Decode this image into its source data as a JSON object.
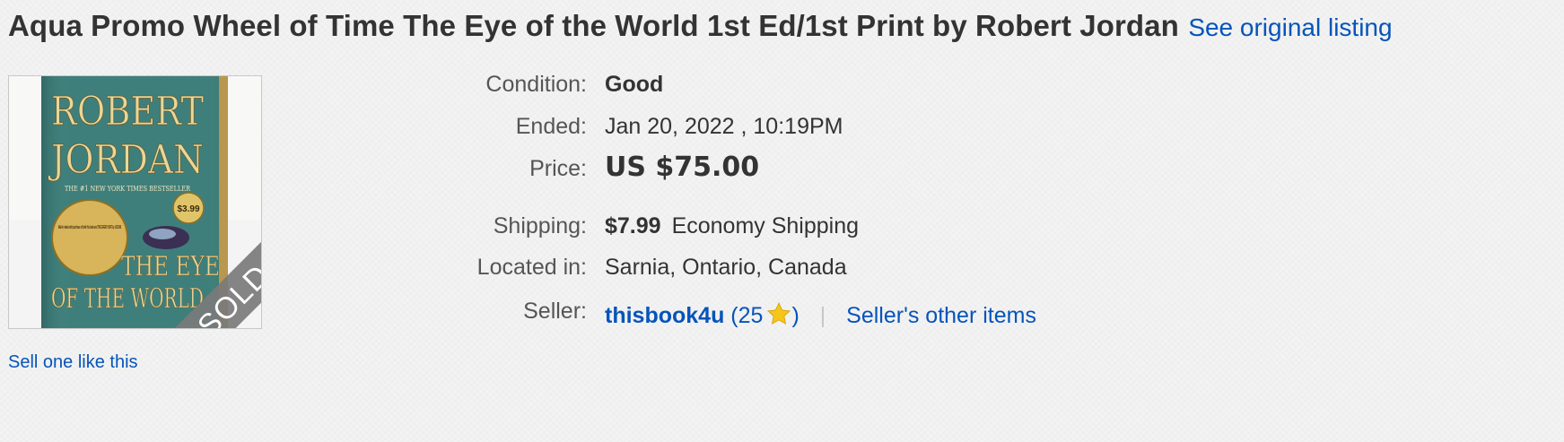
{
  "listing": {
    "title": "Aqua Promo Wheel of Time The Eye of the World 1st Ed/1st Print by Robert Jordan",
    "see_original": "See original listing",
    "sell_one_like_this": "Sell one like this",
    "image": {
      "badge": "SOLD",
      "cover_author_line1": "ROBERT",
      "cover_author_line2": "JORDAN",
      "cover_bestseller": "THE #1 NEW YORK TIMES BESTSELLER",
      "cover_title_line1": "THE EYE",
      "cover_title_line2": "OF THE WORLD",
      "cover_price": "$3.99",
      "cover_promo": "Mail-in rebate with purchase of both this book and THE GREAT HUNT by 10/31/08"
    }
  },
  "details": {
    "condition_label": "Condition:",
    "condition_value": "Good",
    "ended_label": "Ended:",
    "ended_value": "Jan 20, 2022 , 10:19PM",
    "price_label": "Price:",
    "price_value": "US $75.00",
    "shipping_label": "Shipping:",
    "shipping_cost": "$7.99",
    "shipping_service": "Economy Shipping",
    "location_label": "Located in:",
    "location_value": "Sarnia, Ontario, Canada",
    "seller_label": "Seller:",
    "seller_name": "thisbook4u",
    "feedback_open": "(",
    "feedback_score": "25",
    "feedback_close": ")",
    "separator": "|",
    "seller_other_items": "Seller's other items"
  },
  "colors": {
    "link": "#0654ba",
    "text": "#333333",
    "label": "#555555",
    "star": "#f5c518"
  }
}
